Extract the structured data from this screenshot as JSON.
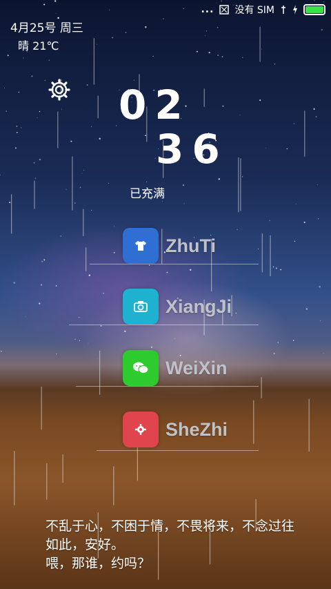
{
  "status_bar": {
    "dots": "...",
    "no_sim_label": "没有 SIM",
    "icons": [
      "sim-card-icon",
      "signal-icon",
      "charging-bolt-icon",
      "battery-icon"
    ],
    "battery_color": "#3ee04a"
  },
  "lock": {
    "date": "4月25号 周三",
    "weather": "晴 21℃",
    "hours": "02",
    "minutes": "36",
    "charge_status": "已充满"
  },
  "apps": [
    {
      "label": "ZhuTi",
      "icon": "shirt-icon",
      "color": "#2f6fd4"
    },
    {
      "label": "XiangJi",
      "icon": "camera-icon",
      "color": "#1fb2d0"
    },
    {
      "label": "WeiXin",
      "icon": "wechat-icon",
      "color": "#2ecb2e"
    },
    {
      "label": "SheZhi",
      "icon": "gear-icon",
      "color": "#e0454e"
    }
  ],
  "poem": {
    "line1": "不乱于心，不困于情，不畏将来，不念过往",
    "line2": "如此，安好。",
    "line3": "喂，那谁，约吗？"
  }
}
